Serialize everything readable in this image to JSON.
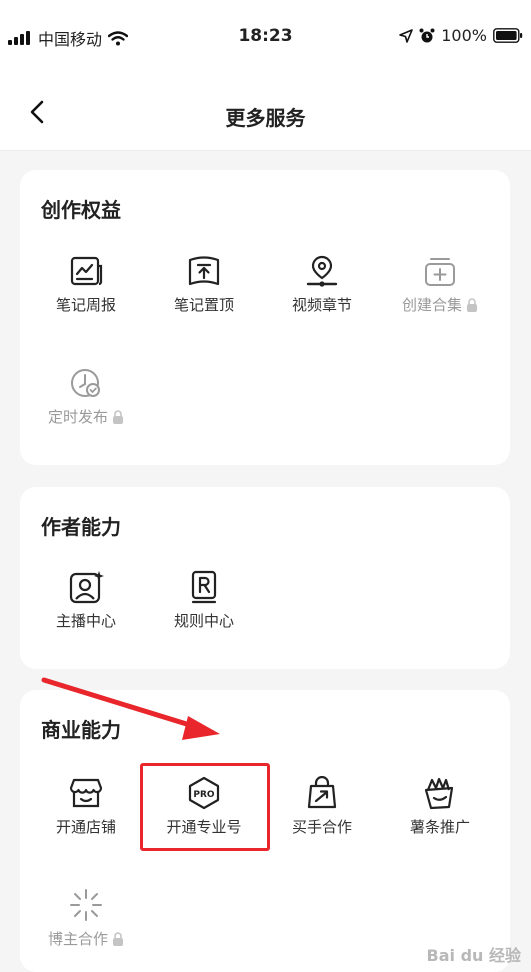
{
  "status_bar": {
    "carrier": "中国移动",
    "time": "18:23",
    "battery": "100%"
  },
  "nav": {
    "title": "更多服务"
  },
  "sections": [
    {
      "title": "创作权益",
      "items": [
        {
          "label": "笔记周报",
          "icon": "report-icon",
          "locked": false
        },
        {
          "label": "笔记置顶",
          "icon": "pin-top-icon",
          "locked": false
        },
        {
          "label": "视频章节",
          "icon": "video-chapter-icon",
          "locked": false
        },
        {
          "label": "创建合集",
          "icon": "collection-add-icon",
          "locked": true
        },
        {
          "label": "定时发布",
          "icon": "scheduled-publish-icon",
          "locked": true
        }
      ]
    },
    {
      "title": "作者能力",
      "items": [
        {
          "label": "主播中心",
          "icon": "host-center-icon",
          "locked": false
        },
        {
          "label": "规则中心",
          "icon": "rules-book-icon",
          "locked": false
        }
      ]
    },
    {
      "title": "商业能力",
      "items": [
        {
          "label": "开通店铺",
          "icon": "shop-icon",
          "locked": false
        },
        {
          "label": "开通专业号",
          "icon": "pro-badge-icon",
          "locked": false
        },
        {
          "label": "买手合作",
          "icon": "shopping-bag-icon",
          "locked": false
        },
        {
          "label": "薯条推广",
          "icon": "fries-promo-icon",
          "locked": false
        },
        {
          "label": "博主合作",
          "icon": "spark-icon",
          "locked": true
        }
      ]
    }
  ],
  "watermark": "Bai du 经验",
  "colors": {
    "highlight": "#e8262b",
    "disabled": "#9a9a9a",
    "background": "#f5f5f5"
  }
}
